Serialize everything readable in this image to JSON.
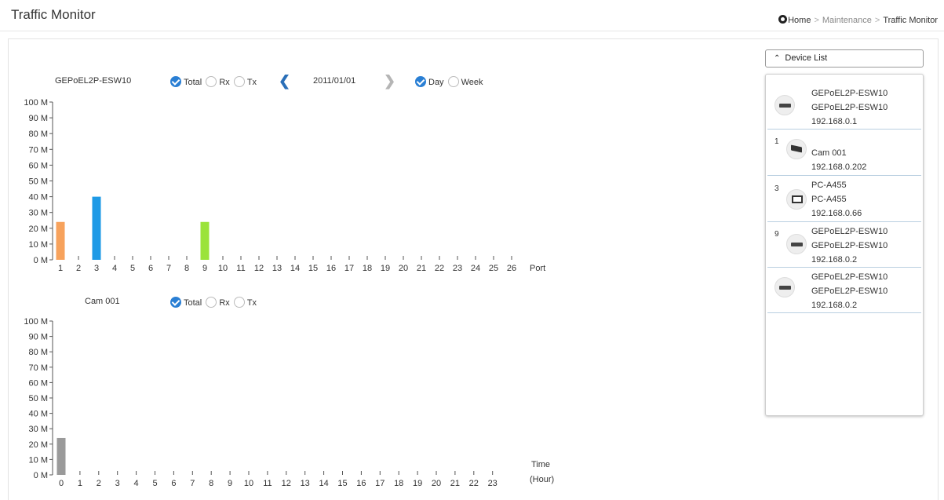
{
  "header": {
    "title": "Traffic Monitor",
    "breadcrumb": {
      "home": "Home",
      "maintenance": "Maintenance",
      "current": "Traffic Monitor",
      "separator": ">"
    }
  },
  "port_chart": {
    "device_name": "GEPoEL2P-ESW10",
    "options": {
      "total": "Total",
      "rx": "Rx",
      "tx": "Tx",
      "selected": "Total"
    },
    "date": "2011/01/01",
    "period": {
      "day": "Day",
      "week": "Week",
      "selected": "Day"
    }
  },
  "time_chart": {
    "device_name": "Cam 001",
    "options": {
      "total": "Total",
      "rx": "Rx",
      "tx": "Tx",
      "selected": "Total"
    }
  },
  "device_list": {
    "button_label": "Device List",
    "items": [
      {
        "port": "",
        "icon": "switch-icon",
        "name": "GEPoEL2P-ESW10",
        "model": "GEPoEL2P-ESW10",
        "ip": "192.168.0.1"
      },
      {
        "port": "1",
        "icon": "camera-icon",
        "name": "",
        "model": "Cam 001",
        "ip": "192.168.0.202"
      },
      {
        "port": "3",
        "icon": "pc-icon",
        "name": "PC-A455",
        "model": "PC-A455",
        "ip": "192.168.0.66"
      },
      {
        "port": "9",
        "icon": "switch-icon",
        "name": "GEPoEL2P-ESW10",
        "model": "GEPoEL2P-ESW10",
        "ip": "192.168.0.2"
      },
      {
        "port": "",
        "icon": "switch-icon",
        "name": "GEPoEL2P-ESW10",
        "model": "GEPoEL2P-ESW10",
        "ip": "192.168.0.2"
      }
    ]
  },
  "chart_data": [
    {
      "type": "bar",
      "xlabel": "Port",
      "ylabel": "",
      "y_ticks": [
        "0 M",
        "10 M",
        "20 M",
        "30 M",
        "40 M",
        "50 M",
        "60 M",
        "70 M",
        "80 M",
        "90 M",
        "100 M"
      ],
      "ylim": [
        0,
        100
      ],
      "categories": [
        "1",
        "2",
        "3",
        "4",
        "5",
        "6",
        "7",
        "8",
        "9",
        "10",
        "11",
        "12",
        "13",
        "14",
        "15",
        "16",
        "17",
        "18",
        "19",
        "20",
        "21",
        "22",
        "23",
        "24",
        "25",
        "26"
      ],
      "values": [
        24,
        0,
        40,
        0,
        0,
        0,
        0,
        0,
        24,
        0,
        0,
        0,
        0,
        0,
        0,
        0,
        0,
        0,
        0,
        0,
        0,
        0,
        0,
        0,
        0,
        0
      ],
      "colors": [
        "#f7a25c",
        "#f7a25c",
        "#1e9ae6",
        "#1e9ae6",
        "#1e9ae6",
        "#1e9ae6",
        "#1e9ae6",
        "#1e9ae6",
        "#9be33a",
        "#9be33a",
        "#9be33a",
        "#9be33a",
        "#9be33a",
        "#9be33a",
        "#9be33a",
        "#9be33a",
        "#9be33a",
        "#9be33a",
        "#9be33a",
        "#9be33a",
        "#9be33a",
        "#9be33a",
        "#9be33a",
        "#9be33a",
        "#9be33a",
        "#9be33a"
      ],
      "grid": false
    },
    {
      "type": "bar",
      "xlabel_line1": "Time",
      "xlabel_line2": "(Hour)",
      "ylabel": "",
      "y_ticks": [
        "0 M",
        "10 M",
        "20 M",
        "30 M",
        "40 M",
        "50 M",
        "60 M",
        "70 M",
        "80 M",
        "90 M",
        "100 M"
      ],
      "ylim": [
        0,
        100
      ],
      "categories": [
        "0",
        "1",
        "2",
        "3",
        "4",
        "5",
        "6",
        "7",
        "8",
        "9",
        "10",
        "11",
        "12",
        "13",
        "14",
        "15",
        "16",
        "17",
        "18",
        "19",
        "20",
        "21",
        "22",
        "23"
      ],
      "values": [
        24,
        0,
        0,
        0,
        0,
        0,
        0,
        0,
        0,
        0,
        0,
        0,
        0,
        0,
        0,
        0,
        0,
        0,
        0,
        0,
        0,
        0,
        0,
        0
      ],
      "colors": [
        "#9a9a9a"
      ],
      "grid": false
    }
  ]
}
